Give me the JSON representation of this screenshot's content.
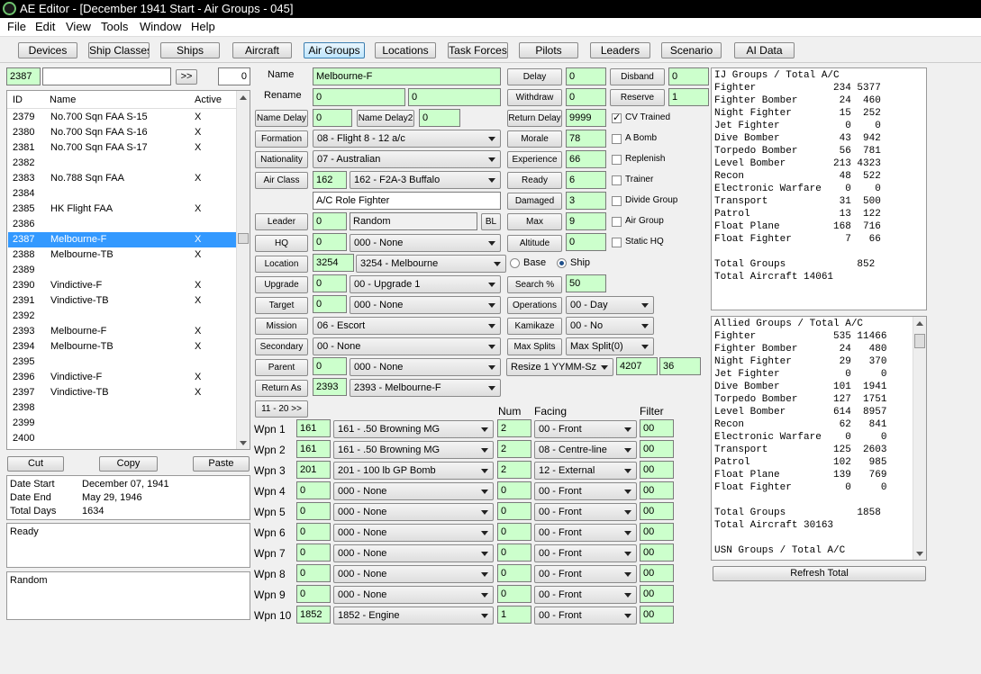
{
  "window": {
    "title": "AE Editor - [December 1941 Start - Air Groups - 045]"
  },
  "menu": [
    "File",
    "Edit",
    "View",
    "Tools",
    "Window",
    "Help"
  ],
  "toolbar": [
    "Devices",
    "Ship Classes",
    "Ships",
    "Aircraft",
    "Air Groups",
    "Locations",
    "Task Forces",
    "Pilots",
    "Leaders",
    "Scenario",
    "AI Data"
  ],
  "search": {
    "id": "2387",
    "text": "",
    "go": ">>",
    "count": "0"
  },
  "list": {
    "headers": [
      "ID",
      "Name",
      "Active"
    ],
    "rows": [
      {
        "id": "2379",
        "name": "No.700 Sqn FAA S-15",
        "active": "X"
      },
      {
        "id": "2380",
        "name": "No.700 Sqn FAA S-16",
        "active": "X"
      },
      {
        "id": "2381",
        "name": "No.700 Sqn FAA S-17",
        "active": "X"
      },
      {
        "id": "2382",
        "name": "",
        "active": ""
      },
      {
        "id": "2383",
        "name": "No.788 Sqn FAA",
        "active": "X"
      },
      {
        "id": "2384",
        "name": "",
        "active": ""
      },
      {
        "id": "2385",
        "name": "HK Flight FAA",
        "active": "X"
      },
      {
        "id": "2386",
        "name": "",
        "active": ""
      },
      {
        "id": "2387",
        "name": "Melbourne-F",
        "active": "X"
      },
      {
        "id": "2388",
        "name": "Melbourne-TB",
        "active": "X"
      },
      {
        "id": "2389",
        "name": "",
        "active": ""
      },
      {
        "id": "2390",
        "name": "Vindictive-F",
        "active": "X"
      },
      {
        "id": "2391",
        "name": "Vindictive-TB",
        "active": "X"
      },
      {
        "id": "2392",
        "name": "",
        "active": ""
      },
      {
        "id": "2393",
        "name": "Melbourne-F",
        "active": "X"
      },
      {
        "id": "2394",
        "name": "Melbourne-TB",
        "active": "X"
      },
      {
        "id": "2395",
        "name": "",
        "active": ""
      },
      {
        "id": "2396",
        "name": "Vindictive-F",
        "active": "X"
      },
      {
        "id": "2397",
        "name": "Vindictive-TB",
        "active": "X"
      },
      {
        "id": "2398",
        "name": "",
        "active": ""
      },
      {
        "id": "2399",
        "name": "",
        "active": ""
      },
      {
        "id": "2400",
        "name": "",
        "active": ""
      }
    ]
  },
  "clip": {
    "cut": "Cut",
    "copy": "Copy",
    "paste": "Paste"
  },
  "dates": {
    "start_label": "Date Start",
    "start": "December 07, 1941",
    "end_label": "Date End",
    "end": "May 29, 1946",
    "total_label": "Total Days",
    "total": "1634"
  },
  "status": {
    "ready": "Ready",
    "random": "Random"
  },
  "form": {
    "name_label": "Name",
    "name": "Melbourne-F",
    "rename_label": "Rename",
    "rename1": "0",
    "rename2": "0",
    "name_delay_label": "Name Delay",
    "name_delay": "0",
    "name_delay2_label": "Name Delay2",
    "name_delay2": "0",
    "formation_label": "Formation",
    "formation": "08 - Flight 8 - 12 a/c",
    "nationality_label": "Nationality",
    "nationality": "07 - Australian",
    "air_class_label": "Air Class",
    "air_class_id": "162",
    "air_class": "162 - F2A-3 Buffalo",
    "ac_role": "A/C Role  Fighter",
    "leader_label": "Leader",
    "leader_id": "0",
    "leader": "Random",
    "bl": "BL",
    "hq_label": "HQ",
    "hq_id": "0",
    "hq": "000 - None",
    "location_label": "Location",
    "location_id": "3254",
    "location": "3254 - Melbourne",
    "base_label": "Base",
    "ship_label": "Ship",
    "upgrade_label": "Upgrade",
    "upgrade_id": "0",
    "upgrade": "00 - Upgrade 1",
    "target_label": "Target",
    "target_id": "0",
    "target": "000 - None",
    "mission_label": "Mission",
    "mission": "06 - Escort",
    "secondary_label": "Secondary",
    "secondary": "00 - None",
    "parent_label": "Parent",
    "parent_id": "0",
    "parent": "000 - None",
    "return_label": "Return As",
    "return_id": "2393",
    "return_as": "2393 - Melbourne-F",
    "page_btn": "11 - 20 >>"
  },
  "mid": {
    "delay_label": "Delay",
    "delay": "0",
    "withdraw_label": "Withdraw",
    "withdraw": "0",
    "return_delay_label": "Return Delay",
    "return_delay": "9999",
    "morale_label": "Morale",
    "morale": "78",
    "experience_label": "Experience",
    "experience": "66",
    "ready_label": "Ready",
    "ready": "6",
    "damaged_label": "Damaged",
    "damaged": "3",
    "max_label": "Max",
    "max": "9",
    "altitude_label": "Altitude",
    "altitude": "0",
    "search_label": "Search %",
    "search": "50",
    "operations_label": "Operations",
    "operations": "00 - Day",
    "kamikaze_label": "Kamikaze",
    "kamikaze": "00 - No",
    "max_splits_label": "Max Splits",
    "max_splits": "Max Split(0)",
    "resize": "Resize 1 YYMM-Sz",
    "resize_val1": "4207",
    "resize_val2": "36",
    "disband_label": "Disband",
    "disband": "0",
    "reserve_label": "Reserve",
    "reserve": "1",
    "checks": [
      {
        "label": "CV Trained",
        "checked": true
      },
      {
        "label": "A Bomb",
        "checked": false
      },
      {
        "label": "Replenish",
        "checked": false
      },
      {
        "label": "Trainer",
        "checked": false
      },
      {
        "label": "Divide Group",
        "checked": false
      },
      {
        "label": "Air Group",
        "checked": false
      },
      {
        "label": "Static HQ",
        "checked": false
      }
    ]
  },
  "weapons": {
    "num_header": "Num",
    "facing_header": "Facing",
    "filter_header": "Filter",
    "rows": [
      {
        "label": "Wpn 1",
        "id": "161",
        "name": "161 - .50 Browning MG",
        "num": "2",
        "facing": "00 - Front",
        "filter": "00"
      },
      {
        "label": "Wpn 2",
        "id": "161",
        "name": "161 - .50 Browning MG",
        "num": "2",
        "facing": "08 - Centre-line",
        "filter": "00"
      },
      {
        "label": "Wpn 3",
        "id": "201",
        "name": "201 - 100 lb GP Bomb",
        "num": "2",
        "facing": "12 - External",
        "filter": "00"
      },
      {
        "label": "Wpn 4",
        "id": "0",
        "name": "000 - None",
        "num": "0",
        "facing": "00 - Front",
        "filter": "00"
      },
      {
        "label": "Wpn 5",
        "id": "0",
        "name": "000 - None",
        "num": "0",
        "facing": "00 - Front",
        "filter": "00"
      },
      {
        "label": "Wpn 6",
        "id": "0",
        "name": "000 - None",
        "num": "0",
        "facing": "00 - Front",
        "filter": "00"
      },
      {
        "label": "Wpn 7",
        "id": "0",
        "name": "000 - None",
        "num": "0",
        "facing": "00 - Front",
        "filter": "00"
      },
      {
        "label": "Wpn 8",
        "id": "0",
        "name": "000 - None",
        "num": "0",
        "facing": "00 - Front",
        "filter": "00"
      },
      {
        "label": "Wpn 9",
        "id": "0",
        "name": "000 - None",
        "num": "0",
        "facing": "00 - Front",
        "filter": "00"
      },
      {
        "label": "Wpn 10",
        "id": "1852",
        "name": "1852 - Engine",
        "num": "1",
        "facing": "00 - Front",
        "filter": "00"
      }
    ]
  },
  "ij": {
    "header": "IJ Groups / Total A/C",
    "rows": [
      {
        "t": "Fighter",
        "a": "234",
        "b": "5377"
      },
      {
        "t": "Fighter Bomber",
        "a": "24",
        "b": "460"
      },
      {
        "t": "Night Fighter",
        "a": "15",
        "b": "252"
      },
      {
        "t": "Jet Fighter",
        "a": "0",
        "b": "0"
      },
      {
        "t": "Dive Bomber",
        "a": "43",
        "b": "942"
      },
      {
        "t": "Torpedo Bomber",
        "a": "56",
        "b": "781"
      },
      {
        "t": "Level Bomber",
        "a": "213",
        "b": "4323"
      },
      {
        "t": "Recon",
        "a": "48",
        "b": "522"
      },
      {
        "t": "Electronic Warfare",
        "a": "0",
        "b": "0"
      },
      {
        "t": "Transport",
        "a": "31",
        "b": "500"
      },
      {
        "t": "Patrol",
        "a": "13",
        "b": "122"
      },
      {
        "t": "Float Plane",
        "a": "168",
        "b": "716"
      },
      {
        "t": "Float Fighter",
        "a": "7",
        "b": "66"
      }
    ],
    "total_groups_label": "Total Groups",
    "total_groups": "852",
    "total_aircraft_label": "Total Aircraft",
    "total_aircraft": "14061"
  },
  "allied": {
    "header": "Allied Groups / Total A/C",
    "rows": [
      {
        "t": "Fighter",
        "a": "535",
        "b": "11466"
      },
      {
        "t": "Fighter Bomber",
        "a": "24",
        "b": "480"
      },
      {
        "t": "Night Fighter",
        "a": "29",
        "b": "370"
      },
      {
        "t": "Jet Fighter",
        "a": "0",
        "b": "0"
      },
      {
        "t": "Dive Bomber",
        "a": "101",
        "b": "1941"
      },
      {
        "t": "Torpedo Bomber",
        "a": "127",
        "b": "1751"
      },
      {
        "t": "Level Bomber",
        "a": "614",
        "b": "8957"
      },
      {
        "t": "Recon",
        "a": "62",
        "b": "841"
      },
      {
        "t": "Electronic Warfare",
        "a": "0",
        "b": "0"
      },
      {
        "t": "Transport",
        "a": "125",
        "b": "2603"
      },
      {
        "t": "Patrol",
        "a": "102",
        "b": "985"
      },
      {
        "t": "Float Plane",
        "a": "139",
        "b": "769"
      },
      {
        "t": "Float Fighter",
        "a": "0",
        "b": "0"
      }
    ],
    "total_groups_label": "Total Groups",
    "total_groups": "1858",
    "total_aircraft_label": "Total Aircraft",
    "total_aircraft": "30163",
    "usn_header": "USN Groups / Total A/C"
  },
  "refresh": "Refresh Total"
}
